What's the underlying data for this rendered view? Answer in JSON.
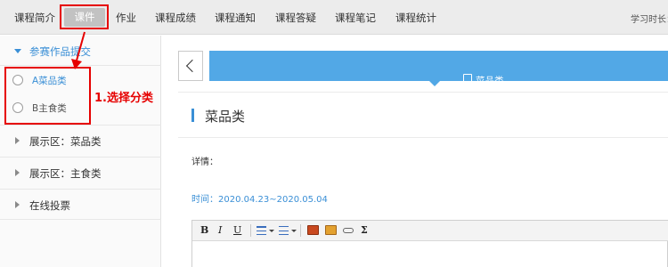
{
  "nav": {
    "items": [
      "课程简介",
      "课件",
      "作业",
      "课程成绩",
      "课程通知",
      "课程答疑",
      "课程笔记",
      "课程统计"
    ],
    "right_text": "学习时长："
  },
  "sidebar": {
    "group_label": "参赛作品提交",
    "sub_items": [
      "A菜品类",
      "B主食类"
    ],
    "items": [
      "展示区：菜品类",
      "展示区：主食类",
      "在线投票"
    ]
  },
  "annotation": {
    "step_label": "1.选择分类",
    "color": "#e60000"
  },
  "main": {
    "banner_label": "菜品类",
    "title": "菜品类",
    "detail_label": "详情：",
    "time_text": "时间：2020.04.23~2020.05.04"
  },
  "editor": {
    "bold": "B",
    "italic": "I",
    "underline": "U",
    "sigma": "Σ"
  },
  "colors": {
    "accent": "#3a8fd6",
    "banner": "#52a8e6"
  }
}
